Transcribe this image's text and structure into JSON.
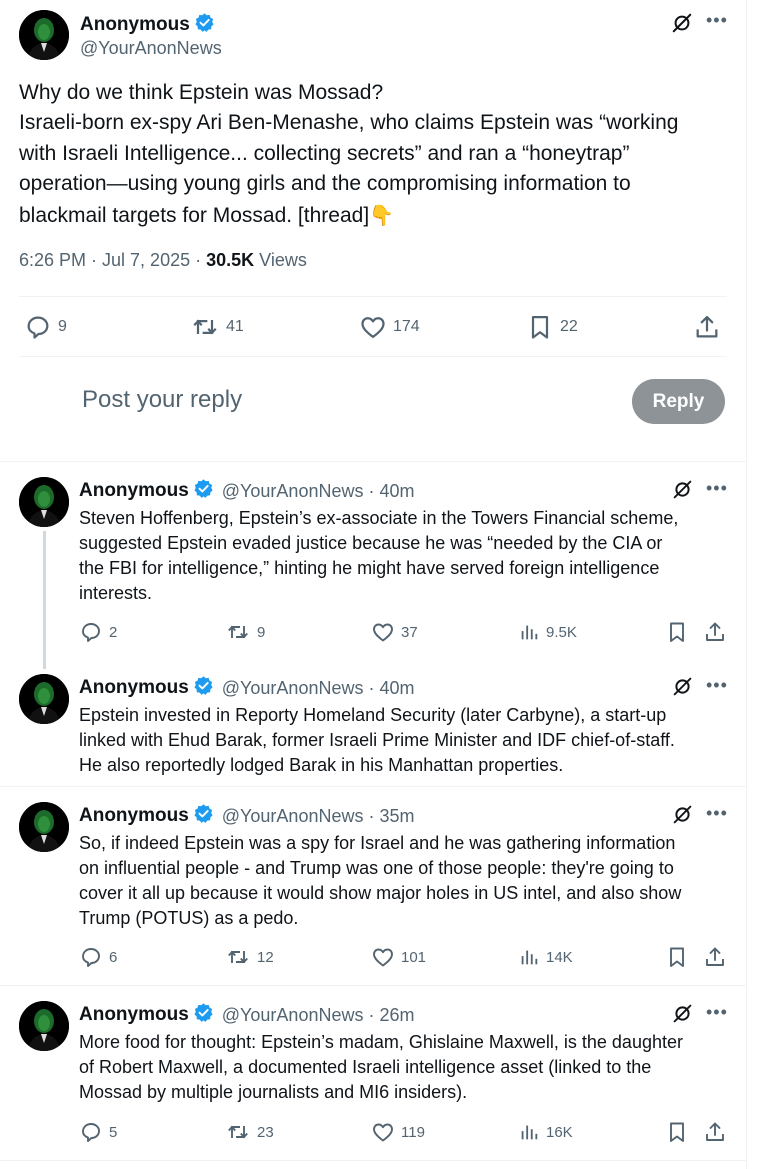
{
  "main_post": {
    "name": "Anonymous",
    "handle": "@YourAnonNews",
    "text_lines": [
      "Why do we think Epstein was Mossad?",
      "Israeli-born ex-spy Ari Ben-Menashe, who claims Epstein was “working",
      "with Israeli Intelligence... collecting secrets” and ran a “honeytrap”",
      "operation—using young girls and the compromising information to",
      "blackmail targets for Mossad. [thread]"
    ],
    "emoji": "👇",
    "time": "6:26 PM · Jul 7, 2025 · ",
    "views_count": "30.5K",
    "views_label": " Views",
    "stats": {
      "replies": "9",
      "reposts": "41",
      "likes": "174",
      "bookmarks": "22"
    }
  },
  "reply_box": {
    "placeholder": "Post your reply",
    "button": "Reply"
  },
  "replies": [
    {
      "name": "Anonymous",
      "handle": "@YourAnonNews",
      "time": "· 40m",
      "text_lines": [
        "Steven Hoffenberg, Epstein’s ex-associate in the Towers Financial scheme,",
        "suggested Epstein evaded justice because he was “needed by the CIA or",
        "the FBI for intelligence,” hinting he might have served foreign intelligence",
        "interests."
      ],
      "stats": {
        "replies": "2",
        "reposts": "9",
        "likes": "37",
        "views": "9.5K"
      }
    },
    {
      "name": "Anonymous",
      "handle": "@YourAnonNews",
      "time": "· 40m",
      "text_lines": [
        "Epstein invested in Reporty Homeland Security (later Carbyne), a start-up",
        "linked with Ehud Barak, former Israeli Prime Minister and IDF chief-of-staff.",
        "He also reportedly lodged Barak in his Manhattan properties."
      ]
    },
    {
      "name": "Anonymous",
      "handle": "@YourAnonNews",
      "time": "· 35m",
      "text_lines": [
        "So, if indeed Epstein was a spy for Israel and he was gathering information",
        "on influential people - and Trump was one of those people: they're going to",
        "cover it all up because it would show major holes in US intel, and also show",
        "Trump (POTUS) as a pedo."
      ],
      "stats": {
        "replies": "6",
        "reposts": "12",
        "likes": "101",
        "views": "14K"
      }
    },
    {
      "name": "Anonymous",
      "handle": "@YourAnonNews",
      "time": "· 26m",
      "text_lines": [
        "More food for thought: Epstein’s madam, Ghislaine Maxwell, is the daughter",
        "of Robert Maxwell, a documented Israeli intelligence asset (linked to the",
        "Mossad by multiple journalists and MI6 insiders)."
      ],
      "stats": {
        "replies": "5",
        "reposts": "23",
        "likes": "119",
        "views": "16K"
      }
    }
  ],
  "colors": {
    "text": "#0f1419",
    "muted": "#536471",
    "verified": "#1d9bf0",
    "separator": "#eff3f4",
    "reply_button": "#8e9398",
    "thread_line": "#cfd9de"
  },
  "icons": [
    "verified-badge-icon",
    "grok-icon",
    "more-icon",
    "reply-icon",
    "repost-icon",
    "like-icon",
    "bookmark-icon",
    "share-icon",
    "views-icon"
  ]
}
